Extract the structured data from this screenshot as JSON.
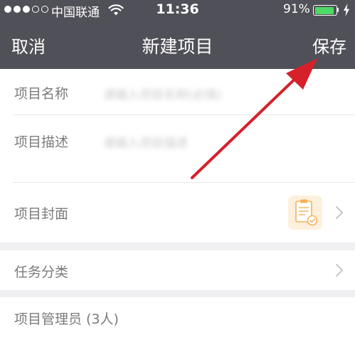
{
  "status_bar": {
    "carrier": "中国联通",
    "time": "11:36",
    "battery_percent": "91%",
    "battery_level": 0.91,
    "signal_bars_filled": 3,
    "signal_bars_total": 5,
    "icons": [
      "signal-dots-icon",
      "wifi-icon",
      "battery-icon",
      "charging-icon"
    ]
  },
  "nav_bar": {
    "cancel_label": "取消",
    "title": "新建项目",
    "save_label": "保存"
  },
  "form": {
    "name": {
      "label": "项目名称",
      "placeholder": "请输入项目名称(必填)"
    },
    "description": {
      "label": "项目描述",
      "placeholder": "请输入项目描述"
    },
    "cover": {
      "label": "项目封面",
      "thumbnail_icon": "clipboard-check-icon"
    },
    "category": {
      "label": "任务分类"
    },
    "managers": {
      "label": "项目管理员 (3人)"
    }
  },
  "colors": {
    "header_bg": "#505058",
    "page_bg": "#f0f0f2",
    "battery_green": "#4cd964",
    "annotation_red": "#d6202a",
    "thumb_orange": "#f3b25d"
  }
}
